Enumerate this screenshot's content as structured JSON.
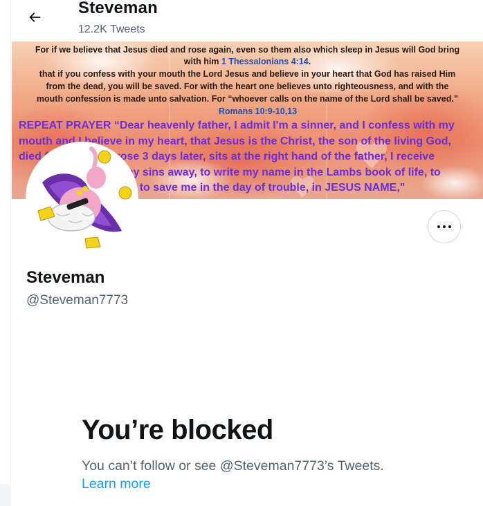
{
  "header": {
    "back_icon": "arrow-left-icon",
    "name": "Steveman",
    "tweet_count": "12.2K Tweets"
  },
  "banner": {
    "lines": [
      {
        "text": "For if we believe that Jesus died and rose again, even so them also which sleep in Jesus will God bring",
        "style": "dark"
      },
      {
        "text": "with him",
        "ref": "1 Thessalonians 4:14",
        "suffix": ".",
        "style": "dark"
      },
      {
        "text": "that if you confess with your mouth the Lord Jesus and believe in your heart that God has raised Him",
        "style": "dark"
      },
      {
        "text": "from the dead, you will be saved. For with the heart one believes unto righteousness, and with the",
        "style": "dark"
      },
      {
        "text": "mouth confession is made unto salvation. For “whoever calls on the name of the Lord shall be saved.”",
        "style": "dark"
      },
      {
        "text": "Romans 10:9-10,13",
        "style": "blue"
      },
      {
        "text": "REPEAT PRAYER “Dear heavenly father, I admit I'm a sinner, and I confess with my",
        "style": "purple"
      },
      {
        "text": "mouth and I believe in my heart, that Jesus is the Christ, the son of the living God,",
        "style": "purple"
      },
      {
        "text": "died for my sins, arose 3 days later, sits at the right hand of the father, I receive",
        "style": "purple"
      },
      {
        "text": "him, to wash my sins away, to write my name in the Lambs book of life, to",
        "style": "purple"
      },
      {
        "text": "forgive me, and to save me in the day of trouble, in JESUS NAME,\"",
        "style": "purple"
      }
    ],
    "colors": {
      "dark": "#2a1a14",
      "blue": "#1d4fb0",
      "purple": "#6a2fd6"
    }
  },
  "avatar": {
    "icon": "avatar-cartoon-character"
  },
  "more_button": {
    "icon": "more-horizontal-icon"
  },
  "profile": {
    "name": "Steveman",
    "handle": "@Steveman7773"
  },
  "blocked": {
    "title": "You’re blocked",
    "message": "You can’t follow or see @Steveman7773’s Tweets.",
    "link": "Learn more",
    "link_color": "#1d9bf0"
  }
}
